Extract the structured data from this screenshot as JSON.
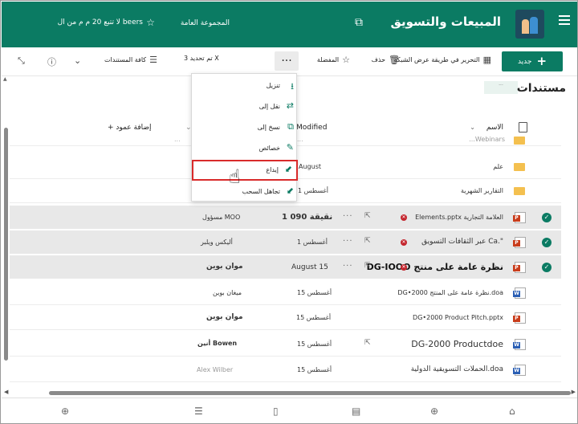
{
  "header": {
    "site_title": "المبيعات والتسويق",
    "group_type": "المجموعة العامة",
    "follow_label": "لا تتبع 20 م م من ال beers",
    "menu_icon": "hamburger-icon",
    "teams_icon": "teams-icon",
    "star_icon": "star-icon"
  },
  "command_bar": {
    "new_label": "جديد",
    "edit_grid_label": "التحرير في طريقة عرض الشبكة",
    "delete_label": "حذف",
    "favorite_label": "المفضلة",
    "ellipsis_label": "...",
    "selected_label": "تم تحديد 3 X",
    "all_docs_label": "كافة المستندات"
  },
  "library": {
    "title": "مستندات",
    "title_bar_text": "..."
  },
  "columns": {
    "name": "الاسم",
    "modified": "Modified",
    "modified_by": "",
    "add_column": "+ إضافة عمود"
  },
  "menu": {
    "items": [
      {
        "label": "تنزيل",
        "icon": "download-icon"
      },
      {
        "label": "نقل إلى",
        "icon": "move-icon"
      },
      {
        "label": "نسخ إلى",
        "icon": "copy-icon"
      },
      {
        "label": "خصائص",
        "icon": "pencil-icon"
      },
      {
        "label": "إيداع",
        "icon": "checkin-icon"
      },
      {
        "label": "تجاهل السحب",
        "icon": "discard-icon"
      }
    ]
  },
  "rows": [
    {
      "type": "folder",
      "name": "...Webinars",
      "modified": "...",
      "modified_by": "..."
    },
    {
      "type": "folder",
      "name": "علم",
      "modified": "August",
      "modified_by": ""
    },
    {
      "type": "folder",
      "name": "التقارير الشهرية",
      "modified": "أغسطس 1",
      "modified_by": ""
    },
    {
      "type": "pptx",
      "name": "Elements.pptx العلامة التجارية",
      "modified": "1 نقيقة 090",
      "modified_by": "مسؤول MOO",
      "selected": true
    },
    {
      "type": "pptx",
      "name": "عبر الثقافات التسويق Ca.\"",
      "modified": "1 أغسطس",
      "modified_by": "أليكس ويلبر",
      "selected": true
    },
    {
      "type": "pptx",
      "name": "DG-IOOO نظرة عامة على منتج",
      "modified": "August 15",
      "modified_by": "موان بوين",
      "selected": true
    },
    {
      "type": "docx",
      "name": "DG•2000 نظرة عامة على المنتج.doa",
      "modified": "15 أغسطس",
      "modified_by": "ميغان بوين"
    },
    {
      "type": "pptx",
      "name": "DG•2000 Product Pitch.pptx",
      "modified": "أغسطس 15",
      "modified_by": "موان بوين"
    },
    {
      "type": "docx",
      "name": "DG-2000 Productdoe",
      "modified": "أغسطس 15",
      "modified_by": "أنين Bowen"
    },
    {
      "type": "docx",
      "name": "الحملات التسويقية الدولية.doa",
      "modified": "15 أغسطس",
      "modified_by": "Alex Wilber"
    }
  ],
  "bottom_nav": {
    "icons": [
      "home-icon",
      "globe-icon",
      "news-icon",
      "file-icon",
      "list-icon",
      "add-icon"
    ]
  },
  "colors": {
    "brand": "#0b7b63",
    "selected_row": "#e8e8e8",
    "highlight": "#d92b2b"
  }
}
